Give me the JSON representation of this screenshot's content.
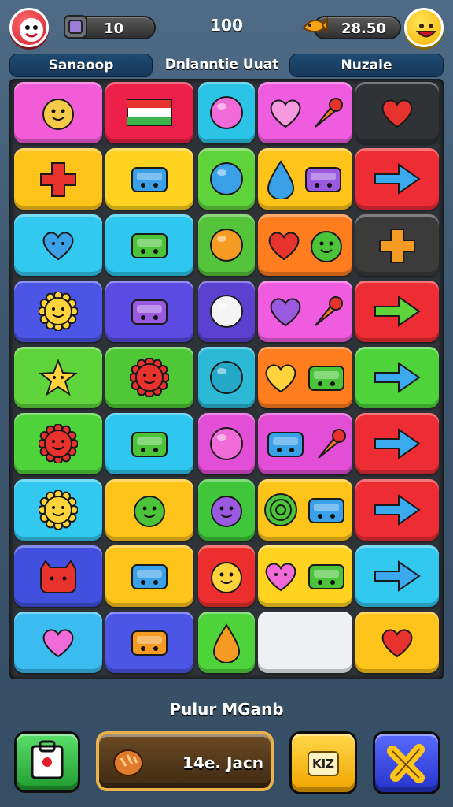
{
  "header": {
    "gems_count": "10",
    "center_count": "100",
    "coins_count": "28.50"
  },
  "tabs": {
    "left_label": "Sanaoop",
    "board_title": "Dnlanntie Uuat",
    "right_label": "Nuzale"
  },
  "board": {
    "rows": [
      [
        {
          "color": "#f25cd7",
          "icons": [
            "smiley-fruit-icon"
          ]
        },
        {
          "color": "#ec2048",
          "icons": [
            "flag-icon"
          ]
        },
        {
          "color": "#2bc4e6",
          "icons": [
            "pink-gem-icon"
          ]
        },
        {
          "color": "#f05ce0",
          "icons": [
            "heart-icon",
            "carrot-icon"
          ]
        },
        {
          "color": "#303336",
          "icons": [
            "red-heart-icon"
          ]
        }
      ],
      [
        {
          "color": "#ffc41a",
          "icons": [
            "red-puzzle-icon"
          ]
        },
        {
          "color": "#ffd31f",
          "icons": [
            "blue-robot-icon"
          ]
        },
        {
          "color": "#5fd33a",
          "icons": [
            "blue-gem-icon"
          ]
        },
        {
          "color": "#ffc41a",
          "icons": [
            "blue-bottle-icon",
            "purple-jar-icon"
          ]
        },
        {
          "color": "#ee2c34",
          "icons": [
            "right-arrow-icon"
          ]
        }
      ],
      [
        {
          "color": "#32c8f0",
          "icons": [
            "blue-heart-face-icon"
          ]
        },
        {
          "color": "#2ec7ef",
          "icons": [
            "green-box-icon"
          ]
        },
        {
          "color": "#54c43a",
          "icons": [
            "orange-gem-icon"
          ]
        },
        {
          "color": "#ff7d1f",
          "icons": [
            "red-heart-icon",
            "green-face-icon"
          ]
        },
        {
          "color": "#3b3b3b",
          "icons": [
            "orange-cross-icon"
          ]
        }
      ],
      [
        {
          "color": "#4b55e6",
          "icons": [
            "sun-face-icon"
          ]
        },
        {
          "color": "#5b4be3",
          "icons": [
            "purple-chest-icon"
          ]
        },
        {
          "color": "#5a41d0",
          "icons": [
            "white-gem-icon"
          ]
        },
        {
          "color": "#f05ce0",
          "icons": [
            "purple-heart-icon",
            "candy-icon"
          ]
        },
        {
          "color": "#ee2c34",
          "icons": [
            "green-arrow-icon"
          ]
        }
      ],
      [
        {
          "color": "#5fd33a",
          "icons": [
            "yellow-star-icon"
          ]
        },
        {
          "color": "#4fc836",
          "icons": [
            "red-sun-icon"
          ]
        },
        {
          "color": "#2bb9d6",
          "icons": [
            "teal-gem-icon"
          ]
        },
        {
          "color": "#ff7d1f",
          "icons": [
            "yellow-heart-icon",
            "green-jar-icon"
          ]
        },
        {
          "color": "#4fd33a",
          "icons": [
            "right-arrow-icon"
          ]
        }
      ],
      [
        {
          "color": "#4fd33a",
          "icons": [
            "red-sun-face-icon"
          ]
        },
        {
          "color": "#2ec7ef",
          "icons": [
            "green-chest-icon"
          ]
        },
        {
          "color": "#e24ed6",
          "icons": [
            "pink-gem-icon"
          ]
        },
        {
          "color": "#e24ed6",
          "icons": [
            "blue-box-icon",
            "carrot-icon"
          ]
        },
        {
          "color": "#ee2c34",
          "icons": [
            "right-arrow-icon"
          ]
        }
      ],
      [
        {
          "color": "#32c8f0",
          "icons": [
            "sun-face-icon"
          ]
        },
        {
          "color": "#ffc41a",
          "icons": [
            "green-face-icon"
          ]
        },
        {
          "color": "#3fc63a",
          "icons": [
            "purple-fruit-icon"
          ]
        },
        {
          "color": "#ffc41a",
          "icons": [
            "green-spiral-icon",
            "blue-battery-icon"
          ]
        },
        {
          "color": "#ee2c34",
          "icons": [
            "right-arrow-icon"
          ]
        }
      ],
      [
        {
          "color": "#4250e0",
          "icons": [
            "red-cat-icon"
          ]
        },
        {
          "color": "#ffc41a",
          "icons": [
            "blue-cube-icon"
          ]
        },
        {
          "color": "#ec2e2e",
          "icons": [
            "yellow-fruit-icon"
          ]
        },
        {
          "color": "#ffd31f",
          "icons": [
            "pink-heart-face-icon",
            "green-camera-icon"
          ]
        },
        {
          "color": "#32c8f0",
          "icons": [
            "right-arrow-icon"
          ]
        }
      ],
      [
        {
          "color": "#3bbcf0",
          "icons": [
            "pink-heart-icon"
          ]
        },
        {
          "color": "#4b55e6",
          "icons": [
            "orange-chest-icon"
          ]
        },
        {
          "color": "#4fd33a",
          "icons": [
            "orange-drop-icon"
          ]
        },
        {
          "color": "#eef0f2",
          "icons": []
        },
        {
          "color": "#ffc41a",
          "icons": [
            "red-heart-icon"
          ]
        }
      ]
    ]
  },
  "footer": {
    "title": "Pulur MGanb",
    "wide_button_label": "14e. Jacn",
    "yellow_button_label": "KIZ"
  }
}
